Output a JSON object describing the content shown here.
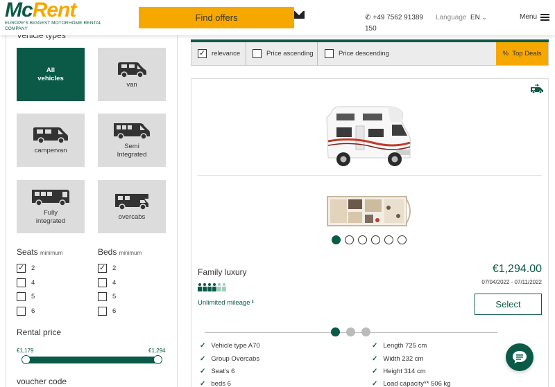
{
  "header": {
    "logo_mc": "Mc",
    "logo_rent": "Rent",
    "tagline": "EUROPE'S BIGGEST MOTORHOME RENTAL COMPANY",
    "find_offers": "Find offers",
    "phone": "+49 7562 91389 150",
    "language_label": "Language",
    "language_value": "EN",
    "menu_label": "Menu"
  },
  "sidebar": {
    "vehicle_types_title": "Vehicle types",
    "vehicle_types": [
      {
        "label_line1": "All",
        "label_line2": "vehicles",
        "icon": "all-vehicles"
      },
      {
        "label_line1": "van",
        "label_line2": "",
        "icon": "van-icon"
      },
      {
        "label_line1": "campervan",
        "label_line2": "",
        "icon": "campervan-icon"
      },
      {
        "label_line1": "Semi",
        "label_line2": "Integrated",
        "icon": "semi-integrated-icon"
      },
      {
        "label_line1": "Fully",
        "label_line2": "integrated",
        "icon": "fully-integrated-icon"
      },
      {
        "label_line1": "overcabs",
        "label_line2": "",
        "icon": "overcab-icon"
      }
    ],
    "seats_label": "Seats",
    "beds_label": "Beds",
    "minimum_label": "minimum",
    "seats_options": [
      {
        "value": "2",
        "checked": true
      },
      {
        "value": "4",
        "checked": false
      },
      {
        "value": "5",
        "checked": false
      },
      {
        "value": "6",
        "checked": false
      }
    ],
    "beds_options": [
      {
        "value": "2",
        "checked": true
      },
      {
        "value": "4",
        "checked": false
      },
      {
        "value": "5",
        "checked": false
      },
      {
        "value": "6",
        "checked": false
      }
    ],
    "rental_price_label": "Rental price",
    "price_min": "€1,179",
    "price_max": "€1,294",
    "voucher_label": "voucher code"
  },
  "sort": {
    "relevance": "relevance",
    "relevance_checked": true,
    "price_asc": "Price ascending",
    "price_desc": "Price descending",
    "top_deals": "Top Deals",
    "top_deals_prefix": "%"
  },
  "vehicle": {
    "name": "Family luxury",
    "mileage": "Unlimited mileage",
    "price": "€1,294.00",
    "dates": "07/04/2022 - 07/11/2022",
    "select_label": "Select",
    "persons_filled": 4,
    "persons_total": 6,
    "specs_left": [
      "Vehicle type A70",
      "Group Overcabs",
      "Seat's 6",
      "beds 6"
    ],
    "specs_right": [
      "Length 725 cm",
      "Width 232 cm",
      "Height 314 cm",
      "Load capacity** 506 kg"
    ]
  },
  "colors": {
    "brand_green": "#0b5a47",
    "brand_orange": "#f6a800"
  }
}
